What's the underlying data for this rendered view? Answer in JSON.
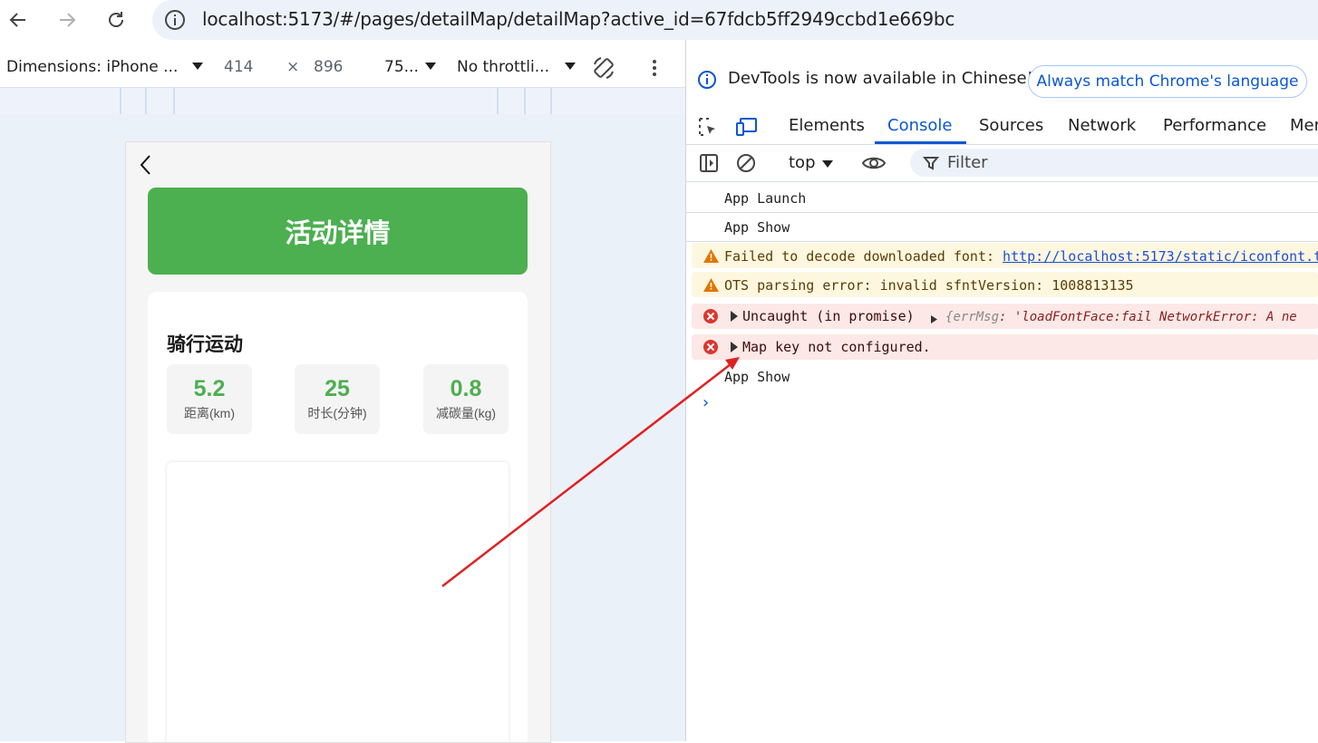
{
  "browser": {
    "url": "localhost:5173/#/pages/detailMap/detailMap?active_id=67fdcb5ff2949ccbd1e669bc"
  },
  "device_toolbar": {
    "dimensions_label": "Dimensions: iPhone ...",
    "width": "414",
    "times": "×",
    "height": "896",
    "zoom": "75...",
    "throttling": "No throttli..."
  },
  "phone": {
    "hero_title": "活动详情",
    "card_title": "骑行运动",
    "stats": [
      {
        "value": "5.2",
        "label": "距离(km)"
      },
      {
        "value": "25",
        "label": "时长(分钟)"
      },
      {
        "value": "0.8",
        "label": "减碳量(kg)"
      }
    ]
  },
  "devtools": {
    "banner_text": "DevTools is now available in Chinese!",
    "banner_button": "Always match Chrome's language",
    "tabs": [
      "Elements",
      "Console",
      "Sources",
      "Network",
      "Performance",
      "Mem"
    ],
    "context": "top",
    "filter_placeholder": "Filter",
    "logs": [
      {
        "type": "log",
        "text": "App Launch"
      },
      {
        "type": "log",
        "text": "App Show"
      },
      {
        "type": "warn",
        "text": "Failed to decode downloaded font: ",
        "link": "http://localhost:5173/static/iconfont.t"
      },
      {
        "type": "warn",
        "text": "OTS parsing error: invalid sfntVersion: 1008813135"
      },
      {
        "type": "error",
        "text": "Uncaught (in promise)",
        "obj_open": "{",
        "obj_key": "errMsg",
        "obj_value": ": 'loadFontFace:fail NetworkError: A ne"
      },
      {
        "type": "error",
        "text": "Map key not configured."
      },
      {
        "type": "log",
        "text": "App Show"
      }
    ],
    "prompt": "›"
  },
  "colors": {
    "accent_green": "#4caf50",
    "devtools_blue": "#0b57d0",
    "annotation_red": "#e02020"
  }
}
